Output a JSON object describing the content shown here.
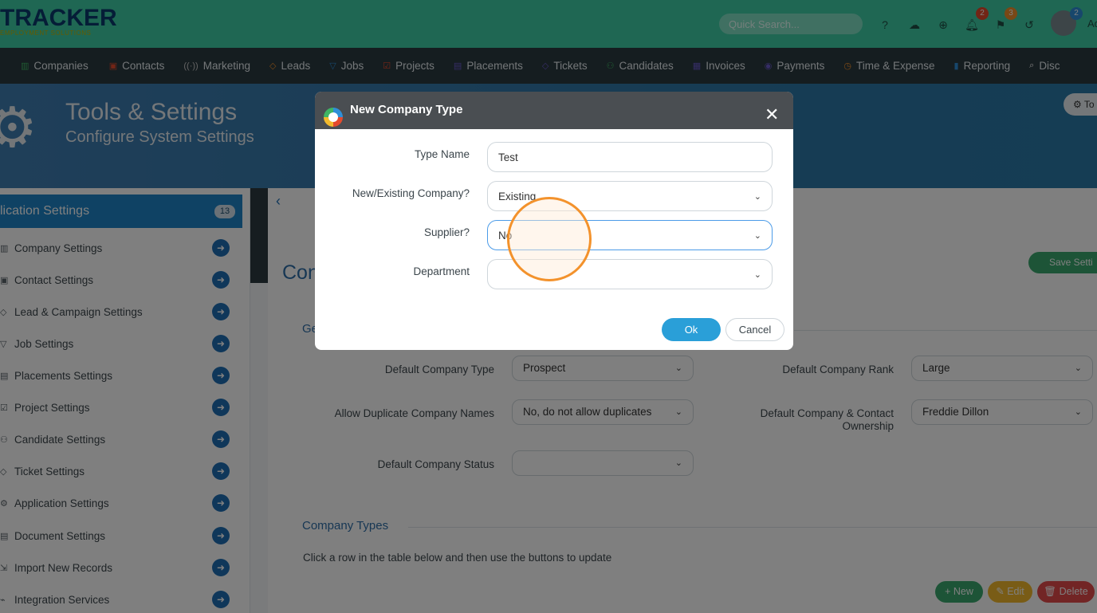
{
  "app": {
    "logo_main": "TRACKER",
    "logo_sub": "EMPLOYMENT SOLUTIONS",
    "search_placeholder": "Quick Search...",
    "notifications": {
      "bell_count": "2",
      "flag_count": "3",
      "avatar_count": "2"
    },
    "user_initials": "Ad"
  },
  "nav": {
    "items": [
      {
        "label": "Companies",
        "icon": "building-icon",
        "color": "#3eb564"
      },
      {
        "label": "Contacts",
        "icon": "contact-card-icon",
        "color": "#e44a2d"
      },
      {
        "label": "Marketing",
        "icon": "broadcast-icon",
        "color": "#c7c7c7"
      },
      {
        "label": "Leads",
        "icon": "diamond-icon",
        "color": "#f2902c"
      },
      {
        "label": "Jobs",
        "icon": "funnel-icon",
        "color": "#2f8fd8"
      },
      {
        "label": "Projects",
        "icon": "checkbox-icon",
        "color": "#e44a2d"
      },
      {
        "label": "Placements",
        "icon": "briefcase-icon",
        "color": "#6a5acd"
      },
      {
        "label": "Tickets",
        "icon": "tag-icon",
        "color": "#6a5acd"
      },
      {
        "label": "Candidates",
        "icon": "people-icon",
        "color": "#3eb564"
      },
      {
        "label": "Invoices",
        "icon": "invoice-icon",
        "color": "#6a5acd"
      },
      {
        "label": "Payments",
        "icon": "coin-icon",
        "color": "#6a5acd"
      },
      {
        "label": "Time & Expense",
        "icon": "clock-icon",
        "color": "#f2902c"
      },
      {
        "label": "Reporting",
        "icon": "bar-chart-icon",
        "color": "#2f8fd8"
      },
      {
        "label": "Disc",
        "icon": "search-icon",
        "color": "#ffffff"
      }
    ]
  },
  "header": {
    "title": "Tools & Settings",
    "subtitle": "Configure System Settings",
    "button_label": "To"
  },
  "sidebar": {
    "title": "lication Settings",
    "count": "13",
    "items": [
      {
        "label": "Company Settings",
        "icon": "building-icon"
      },
      {
        "label": "Contact Settings",
        "icon": "contact-card-icon"
      },
      {
        "label": "Lead & Campaign Settings",
        "icon": "diamond-icon"
      },
      {
        "label": "Job Settings",
        "icon": "funnel-icon"
      },
      {
        "label": "Placements Settings",
        "icon": "briefcase-icon"
      },
      {
        "label": "Project Settings",
        "icon": "checkbox-icon"
      },
      {
        "label": "Candidate Settings",
        "icon": "people-icon"
      },
      {
        "label": "Ticket Settings",
        "icon": "tag-icon"
      },
      {
        "label": "Application Settings",
        "icon": "gear-icon"
      },
      {
        "label": "Document Settings",
        "icon": "document-icon"
      },
      {
        "label": "Import New Records",
        "icon": "import-icon"
      },
      {
        "label": "Integration Services",
        "icon": "plug-icon"
      }
    ]
  },
  "main": {
    "title": "Con",
    "save_label": "Save Setti",
    "general_section": "Ge",
    "fields": {
      "default_company_type": {
        "label": "Default Company Type",
        "value": "Prospect"
      },
      "default_company_rank": {
        "label": "Default Company Rank",
        "value": "Large"
      },
      "allow_duplicates": {
        "label": "Allow Duplicate Company Names",
        "value": "No, do not allow duplicates"
      },
      "default_ownership": {
        "label": "Default Company & Contact Ownership",
        "value": "Freddie Dillon"
      },
      "default_status": {
        "label": "Default Company Status",
        "value": ""
      }
    },
    "company_types_section": "Company Types",
    "company_types_help": "Click a row in the table below and then use the buttons to update",
    "actions": {
      "new": "New",
      "edit": "Edit",
      "delete": "Delete"
    }
  },
  "modal": {
    "title": "New Company Type",
    "fields": {
      "type_name": {
        "label": "Type Name",
        "value": "Test"
      },
      "new_existing": {
        "label": "New/Existing Company?",
        "value": "Existing"
      },
      "supplier": {
        "label": "Supplier?",
        "value": "No"
      },
      "department": {
        "label": "Department",
        "value": ""
      }
    },
    "ok_label": "Ok",
    "cancel_label": "Cancel"
  },
  "colors": {
    "topbar": "#3ecfa6",
    "navbar": "#2b3a40",
    "primary": "#1f85c8",
    "ok_button": "#2a9fd8",
    "click_indicator": "#f3922c"
  }
}
